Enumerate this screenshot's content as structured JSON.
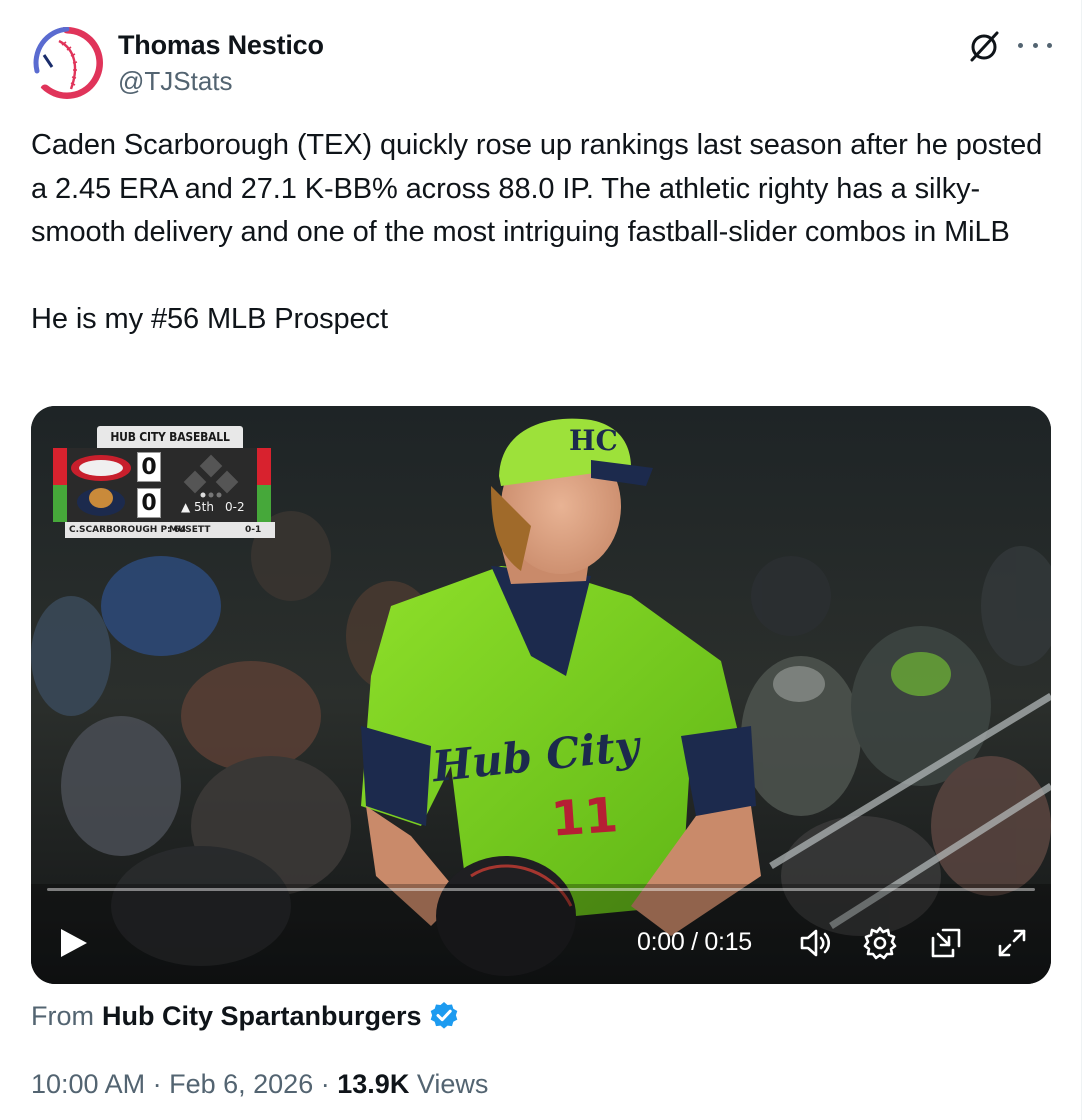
{
  "author": {
    "name": "Thomas Nestico",
    "handle": "@TJStats",
    "avatar_icon": "baseball-logo-icon"
  },
  "header_actions": {
    "grok_icon": "grok-slash-icon",
    "more_icon": "more-horizontal-icon"
  },
  "tweet": {
    "paragraph1": "Caden Scarborough (TEX) quickly rose up rankings last season after he posted a 2.45 ERA and 27.1 K-BB% across 88.0 IP. The athletic righty has a silky-smooth delivery and one of the most intriguing fastball-slider combos in MiLB",
    "paragraph2": "He is my #56 MLB Prospect"
  },
  "video": {
    "scorebug": {
      "title": "HUB CITY BASEBALL",
      "away_score": "0",
      "home_score": "0",
      "inning": "▲ 5th",
      "count": "0-2",
      "pitcher": "C.SCARBOROUGH P: 64",
      "batter": "MUSETT",
      "batter_line": "0-1"
    },
    "jersey_text": "Hub City",
    "jersey_number": "11",
    "time_readout": "0:00 / 0:15",
    "progress_fraction": 0.0,
    "controls": {
      "play": "play-icon",
      "volume": "volume-icon",
      "settings": "settings-gear-icon",
      "pip": "picture-in-picture-icon",
      "fullscreen": "fullscreen-expand-icon"
    }
  },
  "source": {
    "prefix": "From",
    "name": "Hub City Spartanburgers",
    "verified_icon": "verified-badge-icon",
    "verified_color": "#1d9bf0"
  },
  "meta": {
    "time": "10:00 AM",
    "separator": "·",
    "date": "Feb 6, 2026",
    "views_count": "13.9K",
    "views_label": "Views"
  },
  "colors": {
    "text_primary": "#0f1419",
    "text_secondary": "#536471",
    "avatar_red": "#e0345a",
    "avatar_blue": "#1a2d6b",
    "jersey_green": "#7ed321"
  }
}
